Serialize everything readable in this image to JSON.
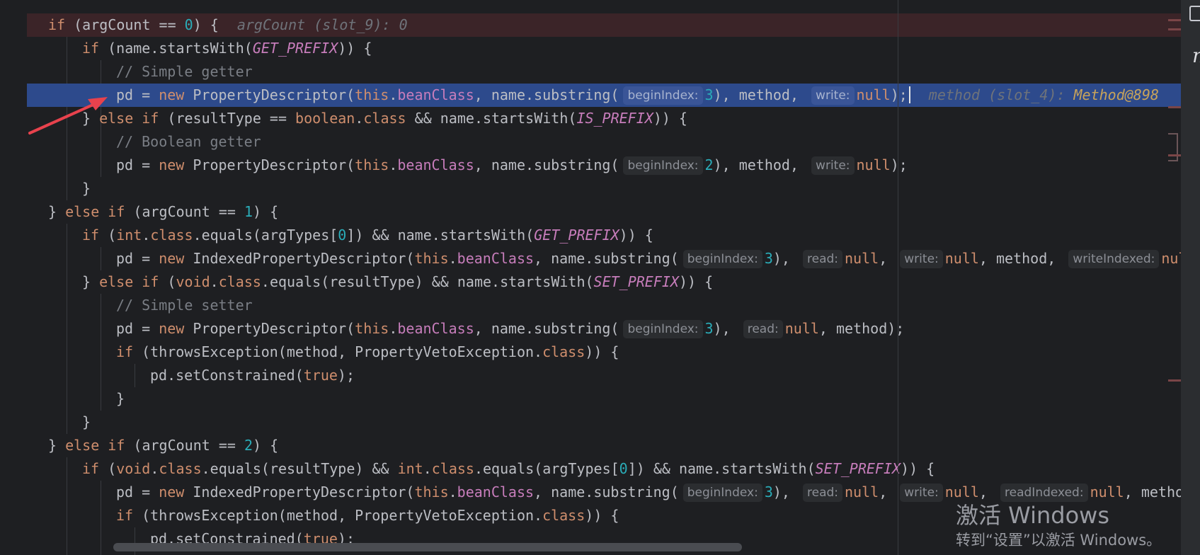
{
  "editor": {
    "lines": [
      {
        "indent": 0,
        "style": "bp",
        "code": [
          [
            "kw",
            "if"
          ],
          [
            "t",
            " (argCount == "
          ],
          [
            "num",
            "0"
          ],
          [
            "t",
            ") {"
          ]
        ],
        "debug": {
          "label": "argCount (slot_9): ",
          "value": "0"
        }
      },
      {
        "indent": 1,
        "code": [
          [
            "kw",
            "if"
          ],
          [
            "t",
            " (name.startsWith("
          ],
          [
            "cst",
            "GET_PREFIX"
          ],
          [
            "t",
            ")) {"
          ]
        ]
      },
      {
        "indent": 2,
        "code": [
          [
            "cmt",
            "// Simple getter"
          ]
        ]
      },
      {
        "indent": 2,
        "style": "cur",
        "code": [
          [
            "t",
            "pd = "
          ],
          [
            "kw",
            "new"
          ],
          [
            "t",
            " PropertyDescriptor("
          ],
          [
            "kw",
            "this"
          ],
          [
            "t",
            "."
          ],
          [
            "fld",
            "beanClass"
          ],
          [
            "t",
            ", name.substring("
          ],
          [
            "hint",
            "beginIndex:"
          ],
          [
            "num",
            "3"
          ],
          [
            "t",
            "), method, "
          ],
          [
            "hint",
            "write:"
          ],
          [
            "kw",
            "null"
          ],
          [
            "t",
            ");"
          ],
          [
            "caret",
            ""
          ]
        ],
        "debug": {
          "label": "method (slot_4): ",
          "value": "Method@898"
        }
      },
      {
        "indent": 1,
        "code": [
          [
            "t",
            "} "
          ],
          [
            "kw",
            "else if"
          ],
          [
            "t",
            " (resultType == "
          ],
          [
            "kw",
            "boolean"
          ],
          [
            "t",
            "."
          ],
          [
            "kw",
            "class"
          ],
          [
            "t",
            " && name.startsWith("
          ],
          [
            "cst",
            "IS_PREFIX"
          ],
          [
            "t",
            ")) {"
          ]
        ]
      },
      {
        "indent": 2,
        "code": [
          [
            "cmt",
            "// Boolean getter"
          ]
        ]
      },
      {
        "indent": 2,
        "code": [
          [
            "t",
            "pd = "
          ],
          [
            "kw",
            "new"
          ],
          [
            "t",
            " PropertyDescriptor("
          ],
          [
            "kw",
            "this"
          ],
          [
            "t",
            "."
          ],
          [
            "fld",
            "beanClass"
          ],
          [
            "t",
            ", name.substring("
          ],
          [
            "hint",
            "beginIndex:"
          ],
          [
            "num",
            "2"
          ],
          [
            "t",
            "), method, "
          ],
          [
            "hint",
            "write:"
          ],
          [
            "kw",
            "null"
          ],
          [
            "t",
            ");"
          ]
        ]
      },
      {
        "indent": 1,
        "code": [
          [
            "t",
            "}"
          ]
        ]
      },
      {
        "indent": 0,
        "code": [
          [
            "t",
            "} "
          ],
          [
            "kw",
            "else if"
          ],
          [
            "t",
            " (argCount == "
          ],
          [
            "num",
            "1"
          ],
          [
            "t",
            ") {"
          ]
        ]
      },
      {
        "indent": 1,
        "code": [
          [
            "kw",
            "if"
          ],
          [
            "t",
            " ("
          ],
          [
            "kw",
            "int"
          ],
          [
            "t",
            "."
          ],
          [
            "kw",
            "class"
          ],
          [
            "t",
            ".equals(argTypes["
          ],
          [
            "num",
            "0"
          ],
          [
            "t",
            "]) && name.startsWith("
          ],
          [
            "cst",
            "GET_PREFIX"
          ],
          [
            "t",
            ")) {"
          ]
        ]
      },
      {
        "indent": 2,
        "code": [
          [
            "t",
            "pd = "
          ],
          [
            "kw",
            "new"
          ],
          [
            "t",
            " IndexedPropertyDescriptor("
          ],
          [
            "kw",
            "this"
          ],
          [
            "t",
            "."
          ],
          [
            "fld",
            "beanClass"
          ],
          [
            "t",
            ", name.substring("
          ],
          [
            "hint",
            "beginIndex:"
          ],
          [
            "num",
            "3"
          ],
          [
            "t",
            "), "
          ],
          [
            "hint",
            "read:"
          ],
          [
            "kw",
            "null"
          ],
          [
            "t",
            ", "
          ],
          [
            "hint",
            "write:"
          ],
          [
            "kw",
            "null"
          ],
          [
            "t",
            ", method, "
          ],
          [
            "hint",
            "writeIndexed:"
          ],
          [
            "kw",
            "nul"
          ]
        ]
      },
      {
        "indent": 1,
        "code": [
          [
            "t",
            "} "
          ],
          [
            "kw",
            "else if"
          ],
          [
            "t",
            " ("
          ],
          [
            "kw",
            "void"
          ],
          [
            "t",
            "."
          ],
          [
            "kw",
            "class"
          ],
          [
            "t",
            ".equals(resultType) && name.startsWith("
          ],
          [
            "cst",
            "SET_PREFIX"
          ],
          [
            "t",
            ")) {"
          ]
        ]
      },
      {
        "indent": 2,
        "code": [
          [
            "cmt",
            "// Simple setter"
          ]
        ]
      },
      {
        "indent": 2,
        "code": [
          [
            "t",
            "pd = "
          ],
          [
            "kw",
            "new"
          ],
          [
            "t",
            " PropertyDescriptor("
          ],
          [
            "kw",
            "this"
          ],
          [
            "t",
            "."
          ],
          [
            "fld",
            "beanClass"
          ],
          [
            "t",
            ", name.substring("
          ],
          [
            "hint",
            "beginIndex:"
          ],
          [
            "num",
            "3"
          ],
          [
            "t",
            "), "
          ],
          [
            "hint",
            "read:"
          ],
          [
            "kw",
            "null"
          ],
          [
            "t",
            ", method);"
          ]
        ]
      },
      {
        "indent": 2,
        "code": [
          [
            "kw",
            "if"
          ],
          [
            "t",
            " (throwsException(method, PropertyVetoException."
          ],
          [
            "kw",
            "class"
          ],
          [
            "t",
            ")) {"
          ]
        ]
      },
      {
        "indent": 3,
        "code": [
          [
            "t",
            "pd.setConstrained("
          ],
          [
            "kw",
            "true"
          ],
          [
            "t",
            ");"
          ]
        ]
      },
      {
        "indent": 2,
        "code": [
          [
            "t",
            "}"
          ]
        ]
      },
      {
        "indent": 1,
        "code": [
          [
            "t",
            "}"
          ]
        ]
      },
      {
        "indent": 0,
        "code": [
          [
            "t",
            "} "
          ],
          [
            "kw",
            "else if"
          ],
          [
            "t",
            " (argCount == "
          ],
          [
            "num",
            "2"
          ],
          [
            "t",
            ") {"
          ]
        ]
      },
      {
        "indent": 1,
        "code": [
          [
            "kw",
            "if"
          ],
          [
            "t",
            " ("
          ],
          [
            "kw",
            "void"
          ],
          [
            "t",
            "."
          ],
          [
            "kw",
            "class"
          ],
          [
            "t",
            ".equals(resultType) && "
          ],
          [
            "kw",
            "int"
          ],
          [
            "t",
            "."
          ],
          [
            "kw",
            "class"
          ],
          [
            "t",
            ".equals(argTypes["
          ],
          [
            "num",
            "0"
          ],
          [
            "t",
            "]) && name.startsWith("
          ],
          [
            "cst",
            "SET_PREFIX"
          ],
          [
            "t",
            ")) {"
          ]
        ]
      },
      {
        "indent": 2,
        "code": [
          [
            "t",
            "pd = "
          ],
          [
            "kw",
            "new"
          ],
          [
            "t",
            " IndexedPropertyDescriptor("
          ],
          [
            "kw",
            "this"
          ],
          [
            "t",
            "."
          ],
          [
            "fld",
            "beanClass"
          ],
          [
            "t",
            ", name.substring("
          ],
          [
            "hint",
            "beginIndex:"
          ],
          [
            "num",
            "3"
          ],
          [
            "t",
            "), "
          ],
          [
            "hint",
            "read:"
          ],
          [
            "kw",
            "null"
          ],
          [
            "t",
            ", "
          ],
          [
            "hint",
            "write:"
          ],
          [
            "kw",
            "null"
          ],
          [
            "t",
            ", "
          ],
          [
            "hint",
            "readIndexed:"
          ],
          [
            "kw",
            "null"
          ],
          [
            "t",
            ", metho"
          ]
        ]
      },
      {
        "indent": 2,
        "code": [
          [
            "kw",
            "if"
          ],
          [
            "t",
            " (throwsException(method, PropertyVetoException."
          ],
          [
            "kw",
            "class"
          ],
          [
            "t",
            ")) {"
          ]
        ]
      },
      {
        "indent": 3,
        "code": [
          [
            "t",
            "pd.setConstrained("
          ],
          [
            "kw",
            "true"
          ],
          [
            "t",
            ");"
          ]
        ]
      }
    ]
  },
  "right_panel": {
    "glyph": "m",
    "icon": "database-icon"
  },
  "watermark": {
    "title": "激活 Windows",
    "subtitle": "转到“设置”以激活 Windows。"
  },
  "colors": {
    "background": "#1e1f22",
    "current_line": "#2d4a8c",
    "breakpoint_line": "#3b2428",
    "annotation_arrow": "#e8424d"
  }
}
